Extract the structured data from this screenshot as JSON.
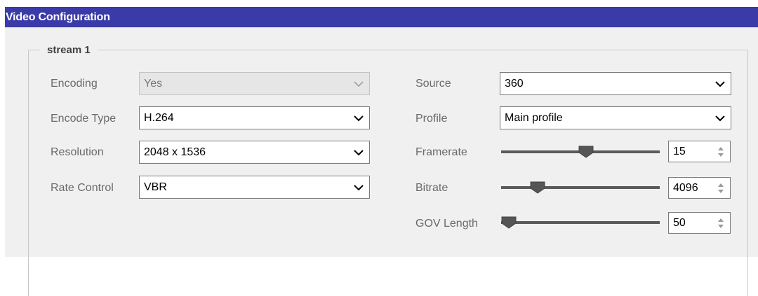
{
  "title": "Video Configuration",
  "group": {
    "legend": "stream 1"
  },
  "fields": {
    "encoding": {
      "label": "Encoding",
      "value": "Yes",
      "disabled": true
    },
    "encode_type": {
      "label": "Encode Type",
      "value": "H.264"
    },
    "resolution": {
      "label": "Resolution",
      "value": "2048 x 1536"
    },
    "rate_control": {
      "label": "Rate Control",
      "value": "VBR"
    },
    "source": {
      "label": "Source",
      "value": "360"
    },
    "profile": {
      "label": "Profile",
      "value": "Main profile"
    },
    "framerate": {
      "label": "Framerate",
      "value": "15",
      "slider_level": 0.54
    },
    "bitrate": {
      "label": "Bitrate",
      "value": "4096",
      "slider_level": 0.2
    },
    "gov_length": {
      "label": "GOV Length",
      "value": "50",
      "slider_level": 0.0
    }
  },
  "colors": {
    "titlebar": "#3a3aa8",
    "panel": "#f0f0f0",
    "label": "#6a6a6a"
  },
  "icons": {
    "dropdown": "chevron-down-icon",
    "spinner": "spin-arrows-icon"
  }
}
